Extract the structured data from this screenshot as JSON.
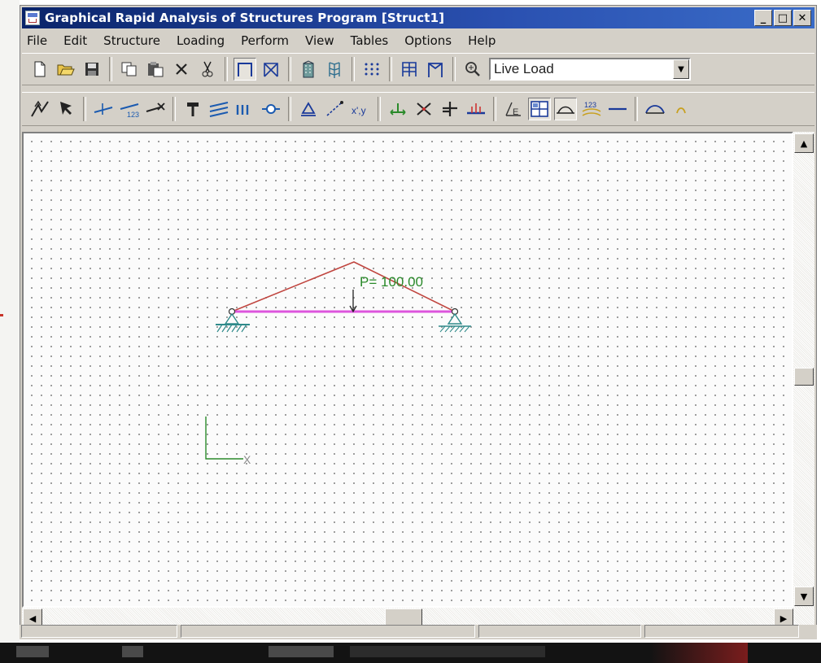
{
  "window": {
    "title": "Graphical Rapid Analysis of Structures Program [Struct1]",
    "controls": {
      "minimize": "_",
      "maximize": "□",
      "close": "✕"
    }
  },
  "menubar": {
    "items": [
      "File",
      "Edit",
      "Structure",
      "Loading",
      "Perform",
      "View",
      "Tables",
      "Options",
      "Help"
    ]
  },
  "toolbar1": {
    "load_case_select": {
      "value": "Live Load"
    },
    "icons": [
      "new-icon",
      "open-icon",
      "save-icon",
      "copy-icon",
      "paste-icon",
      "delete-icon",
      "cut-icon",
      "frame-view-icon",
      "frame-diagonal-icon",
      "building-icon",
      "building-3d-icon",
      "grid-dots-icon",
      "model-icon",
      "portal-frame-icon",
      "zoom-icon"
    ]
  },
  "toolbar2": {
    "icons": [
      "select-joint-icon",
      "select-member-icon",
      "add-member-icon",
      "number-members-icon",
      "delete-member-icon",
      "support-icon",
      "distributed-load-icon",
      "member-load-icon",
      "release-icon",
      "triangle-support-icon",
      "diagonal-icon",
      "xy-coordinates-icon",
      "translate-icon",
      "cross-icon",
      "node-load-icon",
      "moment-icon",
      "elastic-icon",
      "grid-toggle-icon",
      "deflection-icon",
      "numbers-icon",
      "line-icon",
      "arch-icon"
    ],
    "pressed": [
      "grid-toggle-icon",
      "deflection-icon"
    ]
  },
  "canvas": {
    "load_label": "P= 100.00",
    "axis_label": "X"
  },
  "colors": {
    "rafter": "#c0453f",
    "bottom_chord": "#dd55dd",
    "load_label": "#2a8a2a",
    "support": "#2f8a8a",
    "axis": "#2a8a2a"
  }
}
